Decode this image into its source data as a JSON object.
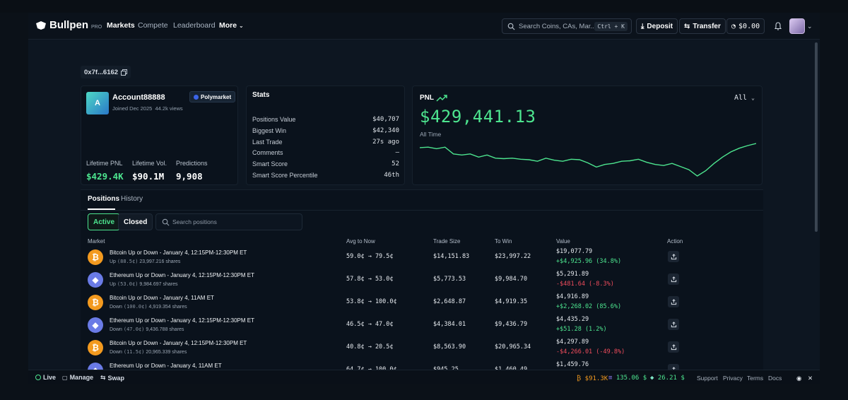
{
  "colors": {
    "accent_green": "#4de58f",
    "negative_red": "#ef4c5c",
    "background": "#0d1621",
    "btc": "#f39a1f",
    "eth": "#6a7be6"
  },
  "nav": {
    "logo_text": "Bullpen",
    "logo_pro": "PRO",
    "links": [
      "Markets",
      "Compete",
      "Leaderboard",
      "More"
    ],
    "search_placeholder": "Search Coins, CAs, Mar...",
    "search_shortcut": "Ctrl + K",
    "deposit": "Deposit",
    "transfer": "Transfer",
    "balance": "$0.00"
  },
  "account": {
    "address": "0x7f...6162",
    "avatar_letter": "A",
    "name": "Account88888",
    "joined": "Joined Dec 2025",
    "views": "44.2k views",
    "platform": "Polymarket",
    "lifetime_pnl_label": "Lifetime PNL",
    "lifetime_pnl": "$429.4K",
    "lifetime_vol_label": "Lifetime Vol.",
    "lifetime_vol": "$90.1M",
    "predictions_label": "Predictions",
    "predictions": "9,908"
  },
  "stats": {
    "title": "Stats",
    "rows": [
      {
        "label": "Positions Value",
        "value": "$40,707"
      },
      {
        "label": "Biggest Win",
        "value": "$42,340"
      },
      {
        "label": "Last Trade",
        "value": "27s ago"
      },
      {
        "label": "Comments",
        "value": "–"
      },
      {
        "label": "Smart Score",
        "value": "52"
      },
      {
        "label": "Smart Score Percentile",
        "value": "46th"
      }
    ]
  },
  "pnl": {
    "label": "PNL",
    "amount": "$429,441.13",
    "range": "All Time",
    "selector": "All"
  },
  "chart_data": {
    "type": "line",
    "title": "PNL",
    "series": [
      {
        "values": [
          0.92,
          0.93,
          0.9,
          0.93,
          0.8,
          0.78,
          0.8,
          0.74,
          0.78,
          0.72,
          0.71,
          0.72,
          0.7,
          0.69,
          0.66,
          0.72,
          0.68,
          0.66,
          0.7,
          0.69,
          0.63,
          0.55,
          0.6,
          0.62,
          0.66,
          0.67,
          0.7,
          0.64,
          0.6,
          0.58,
          0.62,
          0.56,
          0.5,
          0.38,
          0.48,
          0.62,
          0.74,
          0.84,
          0.91,
          0.96,
          1.0
        ]
      }
    ]
  },
  "positions": {
    "tabs": [
      "Positions",
      "History"
    ],
    "filters": [
      "Active",
      "Closed"
    ],
    "search_placeholder": "Search positions",
    "columns": [
      "Market",
      "Avg to Now",
      "Trade Size",
      "To Win",
      "Value",
      "Action"
    ],
    "rows": [
      {
        "coin": "btc",
        "icon": "bitcoin-icon",
        "glyph": "₿",
        "title": "Bitcoin Up or Down - January 4, 12:15PM-12:30PM ET",
        "side": "Up",
        "price": "(88.5¢)",
        "shares": "23,997.216 shares",
        "avg": "59.0¢ → 79.5¢",
        "size": "$14,151.83",
        "towin": "$23,997.22",
        "value": "$19,077.79",
        "change": "+$4,925.96 (34.8%)",
        "sign": "pos"
      },
      {
        "coin": "eth",
        "icon": "ethereum-icon",
        "glyph": "◆",
        "title": "Ethereum Up or Down - January 4, 12:15PM-12:30PM ET",
        "side": "Up",
        "price": "(53.0¢)",
        "shares": "9,984.697 shares",
        "avg": "57.8¢ → 53.0¢",
        "size": "$5,773.53",
        "towin": "$9,984.70",
        "value": "$5,291.89",
        "change": "-$481.64 (-8.3%)",
        "sign": "neg"
      },
      {
        "coin": "btc",
        "icon": "bitcoin-icon",
        "glyph": "₿",
        "title": "Bitcoin Up or Down - January 4, 11AM ET",
        "side": "Down",
        "price": "(100.0¢)",
        "shares": "4,919.354 shares",
        "avg": "53.8¢ → 100.0¢",
        "size": "$2,648.87",
        "towin": "$4,919.35",
        "value": "$4,916.89",
        "change": "+$2,268.02 (85.6%)",
        "sign": "pos"
      },
      {
        "coin": "eth",
        "icon": "ethereum-icon",
        "glyph": "◆",
        "title": "Ethereum Up or Down - January 4, 12:15PM-12:30PM ET",
        "side": "Down",
        "price": "(47.0¢)",
        "shares": "9,436.788 shares",
        "avg": "46.5¢ → 47.0¢",
        "size": "$4,384.01",
        "towin": "$9,436.79",
        "value": "$4,435.29",
        "change": "+$51.28 (1.2%)",
        "sign": "pos"
      },
      {
        "coin": "btc",
        "icon": "bitcoin-icon",
        "glyph": "₿",
        "title": "Bitcoin Up or Down - January 4, 12:15PM-12:30PM ET",
        "side": "Down",
        "price": "(11.5¢)",
        "shares": "20,965.339 shares",
        "avg": "40.8¢ → 20.5¢",
        "size": "$8,563.90",
        "towin": "$20,965.34",
        "value": "$4,297.89",
        "change": "-$4,266.01 (-49.8%)",
        "sign": "neg"
      },
      {
        "coin": "eth",
        "icon": "ethereum-icon",
        "glyph": "◆",
        "title": "Ethereum Up or Down - January 4, 11AM ET",
        "side": "",
        "price": "",
        "shares": "",
        "avg": "64.7¢ → 100.0¢",
        "size": "$945.25",
        "towin": "$1,460.49",
        "value": "$1,459.76",
        "change": "",
        "sign": "pos"
      }
    ]
  },
  "bottom_bar": {
    "live": "Live",
    "manage": "Manage",
    "swap": "Swap",
    "btc_price": "$91.3K",
    "sol_price": "135.06 $",
    "hype_price": "26.21 $",
    "links": [
      "Support",
      "Privacy",
      "Terms",
      "Docs"
    ]
  }
}
